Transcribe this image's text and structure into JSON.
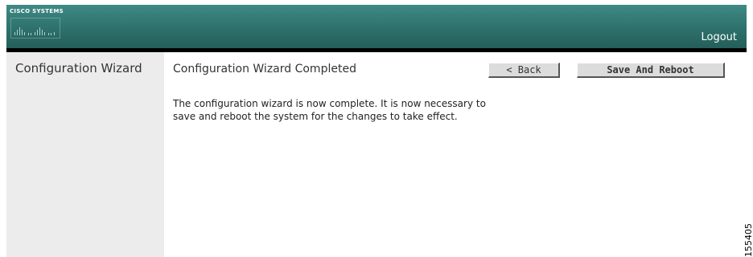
{
  "header": {
    "brand_name": "Cisco Systems",
    "brand_text": "CISCO SYSTEMS",
    "logout_label": "Logout",
    "colors": {
      "bar": "#2e716c",
      "underline": "#000000"
    }
  },
  "sidebar": {
    "title": "Configuration Wizard"
  },
  "main": {
    "title": "Configuration Wizard Completed",
    "back_label": "< Back",
    "save_label": "Save And Reboot",
    "body_text": "The configuration wizard is now complete. It is now necessary to save and reboot the system for the changes to take effect."
  },
  "figure_stamp": "155405"
}
